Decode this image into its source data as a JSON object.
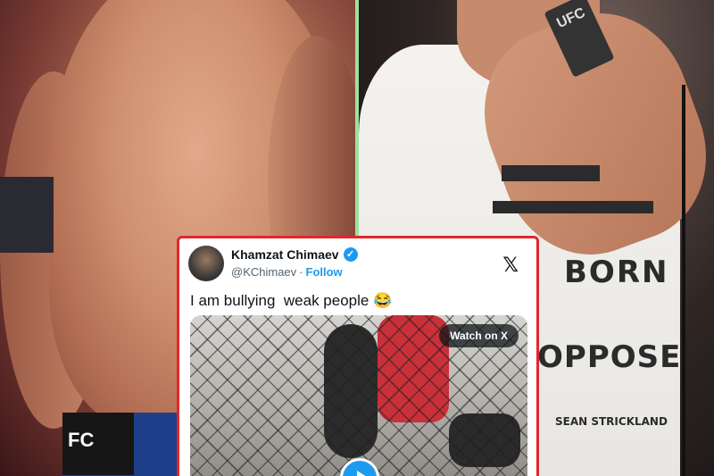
{
  "left_photo": {
    "waistband_text": "FC"
  },
  "right_photo": {
    "mic_logo": "UFC",
    "shirt_words": [
      "BORN",
      "OPPOSE"
    ],
    "shirt_tag": "SEAN STRICKLAND"
  },
  "tweet": {
    "display_name": "Khamzat Chimaev",
    "handle": "@KChimaev",
    "separator": "·",
    "follow_label": "Follow",
    "platform_logo": "𝕏",
    "text": "I am bullying  weak people 😂",
    "media_button": "Watch on X",
    "verified_icon": "verified-badge-icon",
    "accent_color": "#1d9bf0",
    "border_color": "#e3262c"
  }
}
